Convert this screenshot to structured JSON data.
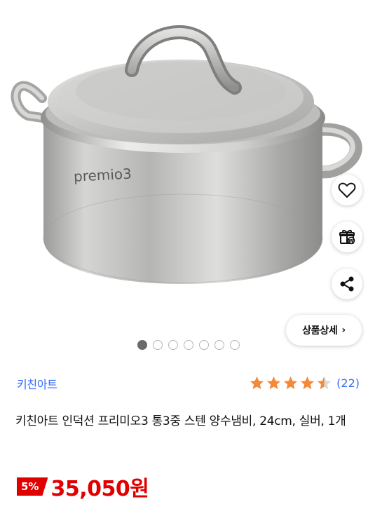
{
  "product": {
    "brand": "키친아트",
    "rating_count": "(22)",
    "rating_value": 4.5,
    "rating_max": 5,
    "title": "키친아트 인덕션 프리미오3 통3중 스텐 양수냄비, 24cm, 실버, 1개",
    "discount_label": "5%",
    "price": "35,050원",
    "pot_engraving": "premio3"
  },
  "actions": {
    "detail_label": "상품상세",
    "detail_chevron": "›"
  },
  "carousel": {
    "total": 7,
    "current": 1
  },
  "icons": {
    "wishlist": "heart-icon",
    "gift": "gift-icon",
    "share": "share-icon",
    "star": "star-icon"
  },
  "colors": {
    "accent_blue": "#346aff",
    "price_red": "#e00000",
    "star_orange": "#f38a3a"
  }
}
